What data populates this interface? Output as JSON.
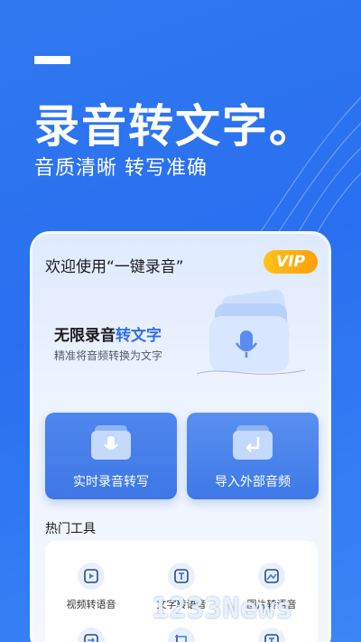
{
  "hero": {
    "title": "录音转文字。",
    "subtitle": "音质清晰 转写准确"
  },
  "app": {
    "welcome": "欢迎使用“一键录音”",
    "vip_label": "VIP",
    "feature_title_prefix": "无限录音",
    "feature_title_accent": "转文字",
    "feature_desc": "精准将音频转换为文字"
  },
  "actions": [
    {
      "label": "实时录音转写",
      "icon": "mic-folder-icon"
    },
    {
      "label": "导入外部音频",
      "icon": "import-folder-icon"
    }
  ],
  "tools_section": {
    "title": "热门工具",
    "items": [
      {
        "label": "视频转语音",
        "icon": "video-icon"
      },
      {
        "label": "文字转语音",
        "icon": "text-icon"
      },
      {
        "label": "图片转语音",
        "icon": "image-icon"
      }
    ]
  },
  "colors": {
    "brand_blue": "#2f79f0",
    "accent_text": "#2f6fe8",
    "vip_orange": "#ffb015"
  },
  "watermark": "1233News"
}
